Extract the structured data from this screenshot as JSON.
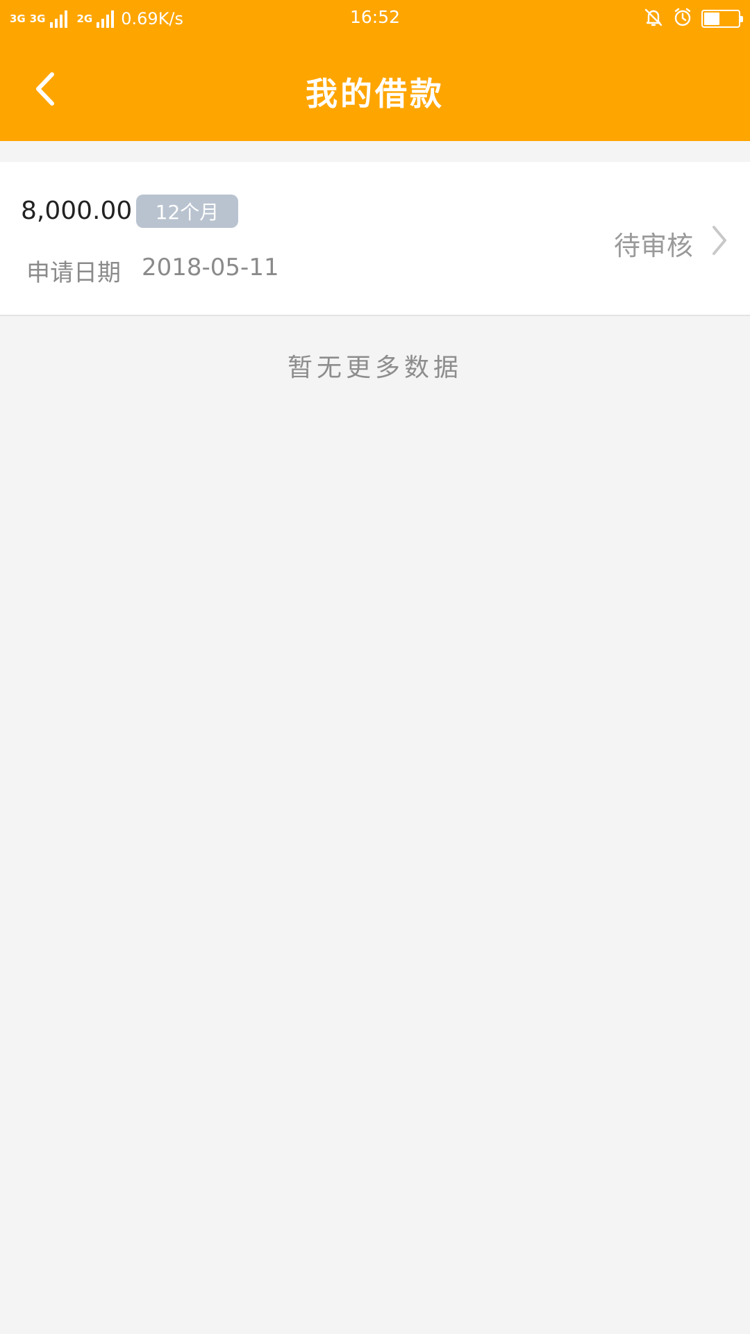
{
  "status_bar": {
    "net1": "3G",
    "net2": "3G",
    "net3": "2G",
    "speed": "0.69K/s",
    "time": "16:52",
    "battery_level": 0.45
  },
  "header": {
    "title": "我的借款"
  },
  "loan": {
    "amount": "8,000.00",
    "term": "12个月",
    "date_label": "申请日期",
    "date_value": "2018-05-11",
    "status": "待审核"
  },
  "footer_note": "暂无更多数据",
  "colors": {
    "brand": "#ffa500",
    "badge": "#b9c3d0",
    "background": "#f4f4f4"
  },
  "icons": {
    "back": "chevron-left-icon",
    "bell": "bell-muted-icon",
    "alarm": "alarm-clock-icon",
    "battery": "battery-icon",
    "arrow": "chevron-right-icon"
  }
}
